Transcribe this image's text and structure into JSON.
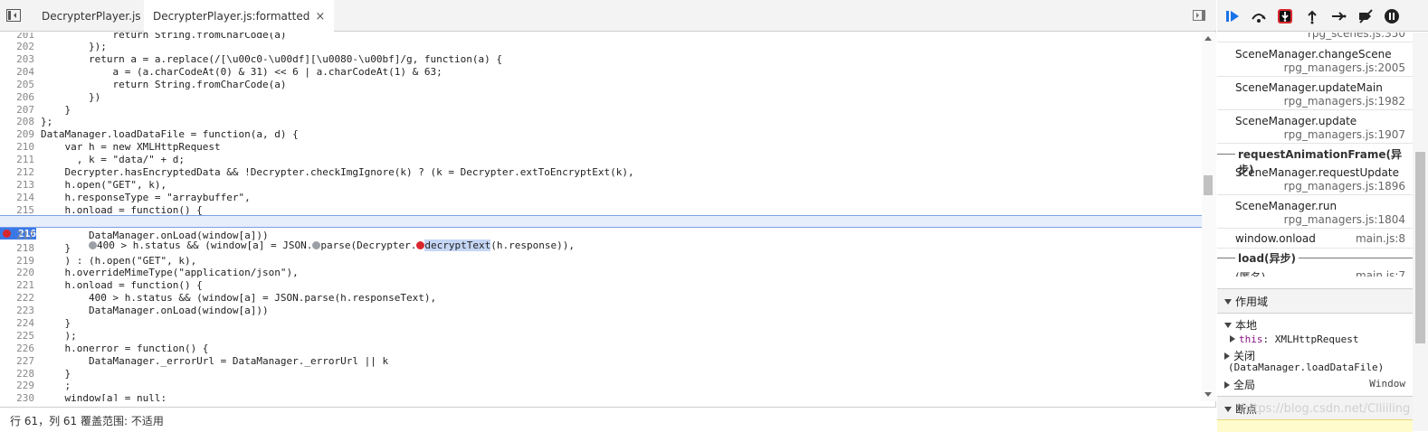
{
  "tabs": [
    {
      "label": "DecrypterPlayer.js"
    },
    {
      "label": "DecrypterPlayer.js:formatted",
      "close": "×"
    }
  ],
  "code_lines": [
    {
      "n": "201",
      "t": "            return String.fromCharCode(a)"
    },
    {
      "n": "202",
      "t": "        });"
    },
    {
      "n": "203",
      "t": "        return a = a.replace(/[\\u00c0-\\u00df][\\u0080-\\u00bf]/g, function(a) {"
    },
    {
      "n": "204",
      "t": "            a = (a.charCodeAt(0) & 31) << 6 | a.charCodeAt(1) & 63;"
    },
    {
      "n": "205",
      "t": "            return String.fromCharCode(a)"
    },
    {
      "n": "206",
      "t": "        })"
    },
    {
      "n": "207",
      "t": "    }"
    },
    {
      "n": "208",
      "t": "};"
    },
    {
      "n": "209",
      "t": "DataManager.loadDataFile = function(a, d) {"
    },
    {
      "n": "210",
      "t": "    var h = new XMLHttpRequest"
    },
    {
      "n": "211",
      "t": "      , k = \"data/\" + d;"
    },
    {
      "n": "212",
      "t": "    Decrypter.hasEncryptedData && !Decrypter.checkImgIgnore(k) ? (k = Decrypter.extToEncryptExt(k),"
    },
    {
      "n": "213",
      "t": "    h.open(\"GET\", k),"
    },
    {
      "n": "214",
      "t": "    h.responseType = \"arraybuffer\","
    },
    {
      "n": "215",
      "t": "    h.onload = function() {"
    },
    {
      "n": "216",
      "t": ""
    },
    {
      "n": "217",
      "t": "        DataManager.onLoad(window[a]))"
    },
    {
      "n": "218",
      "t": "    }"
    },
    {
      "n": "219",
      "t": "    ) : (h.open(\"GET\", k),"
    },
    {
      "n": "220",
      "t": "    h.overrideMimeType(\"application/json\"),"
    },
    {
      "n": "221",
      "t": "    h.onload = function() {"
    },
    {
      "n": "222",
      "t": "        400 > h.status && (window[a] = JSON.parse(h.responseText),"
    },
    {
      "n": "223",
      "t": "        DataManager.onLoad(window[a]))"
    },
    {
      "n": "224",
      "t": "    }"
    },
    {
      "n": "225",
      "t": "    );"
    },
    {
      "n": "226",
      "t": "    h.onerror = function() {"
    },
    {
      "n": "227",
      "t": "        DataManager._errorUrl = DataManager._errorUrl || k"
    },
    {
      "n": "228",
      "t": "    }"
    },
    {
      "n": "229",
      "t": "    ;"
    },
    {
      "n": "230",
      "t": "    window[a] = null;"
    }
  ],
  "breakpoint_line": {
    "n": "216",
    "pre": "        ",
    "seg1": "400 > h.status && (window[a] = JSON.",
    "seg2": "parse(Decrypter.",
    "selected": "decryptText",
    "post": "(h.response)),"
  },
  "status_bar": {
    "text": "行 61，列 61   覆盖范围: 不适用"
  },
  "call_stack": {
    "top_partial": {
      "loc": "rpg_scenes.js:350"
    },
    "frames": [
      {
        "fn": "SceneManager.changeScene",
        "loc": "rpg_managers.js:2005"
      },
      {
        "fn": "SceneManager.updateMain",
        "loc": "rpg_managers.js:1982"
      },
      {
        "fn": "SceneManager.update",
        "loc": "rpg_managers.js:1907"
      }
    ],
    "async1": "requestAnimationFrame(异步)",
    "frames2": [
      {
        "fn": "SceneManager.requestUpdate",
        "loc": "rpg_managers.js:1896"
      },
      {
        "fn": "SceneManager.run",
        "loc": "rpg_managers.js:1804"
      }
    ],
    "window_onload": {
      "fn": "window.onload",
      "loc": "main.js:8"
    },
    "async2": "load(异步)",
    "anon": {
      "fn": "(匿名)",
      "loc": "main.js:7"
    }
  },
  "scope": {
    "header": "作用域",
    "local": "本地",
    "this_key": "this",
    "this_val": "XMLHttpRequest",
    "closure": "关闭",
    "closure_sub": "(DataManager.loadDataFile)",
    "global": "全局",
    "global_val": "Window"
  },
  "breakpoints_header": "断点",
  "watermark": "https://blog.csdn.net/Clliiling",
  "colors": {
    "accent": "#3b78e7",
    "breakpoint": "#d9272e",
    "pause_highlight": "#d9272e"
  }
}
